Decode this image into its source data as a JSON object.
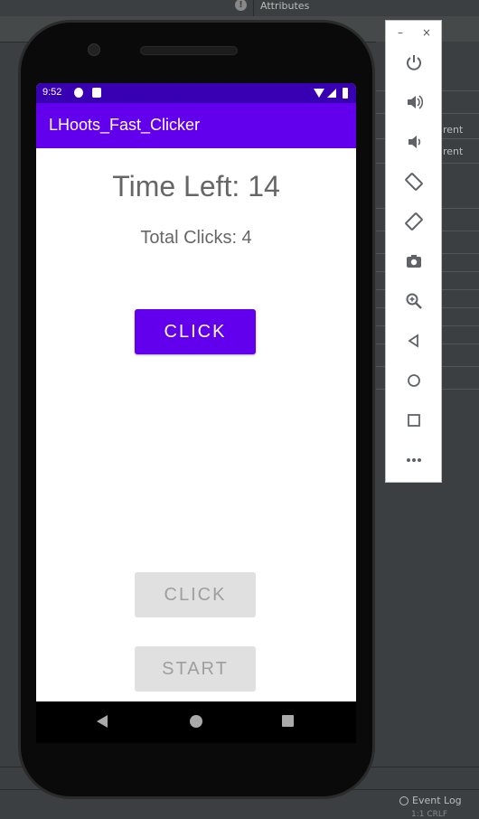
{
  "ide": {
    "panel_title": "Attributes",
    "right_rows": [
      "rent",
      "rent"
    ],
    "event_log_label": "Event Log",
    "status_text": "1:1   CRLF"
  },
  "emulator_toolbar": {
    "window_controls": [
      "–",
      "×"
    ],
    "buttons": [
      "power-icon",
      "volume-up-icon",
      "volume-down-icon",
      "rotate-left-icon",
      "rotate-right-icon",
      "camera-icon",
      "zoom-icon",
      "back-icon",
      "home-icon",
      "overview-icon",
      "more-icon"
    ]
  },
  "device": {
    "status_bar": {
      "time": "9:52"
    },
    "app_title": "LHoots_Fast_Clicker",
    "time_left_text": "Time Left: 14",
    "total_clicks_text": "Total Clicks: 4",
    "click_button_label": "CLICK",
    "click_button_disabled_label": "CLICK",
    "start_button_label": "START"
  },
  "colors": {
    "primary": "#6200ee",
    "primary_dark": "#3700b3",
    "disabled_bg": "#e0e0e0",
    "disabled_text": "#9e9e9e"
  }
}
